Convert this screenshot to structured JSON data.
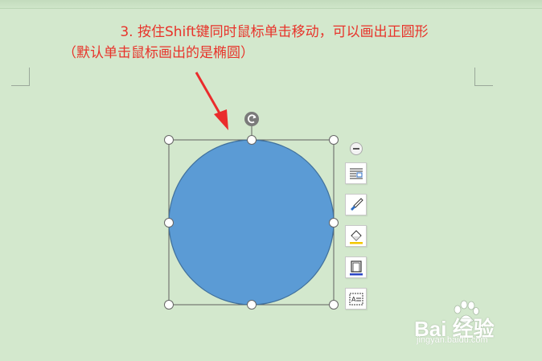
{
  "instruction": {
    "line1": "3. 按住Shift键同时鼠标单击移动，可以画出正圆形",
    "line2": "（默认单击鼠标画出的是椭圆）"
  },
  "colors": {
    "background": "#d3e8cd",
    "caption": "#e8332a",
    "arrow": "#ea2c2c",
    "shape_fill": "#5b9bd5",
    "shape_stroke": "#41719c"
  },
  "shape": {
    "type": "circle",
    "selected": true
  },
  "side_tools": [
    {
      "name": "layout-options-icon"
    },
    {
      "name": "shape-style-brush-icon"
    },
    {
      "name": "fill-bucket-icon"
    },
    {
      "name": "outline-icon"
    },
    {
      "name": "text-box-icon"
    }
  ],
  "watermark": {
    "brand": "Bai 经验",
    "url": "jingyan.baidu.com"
  }
}
